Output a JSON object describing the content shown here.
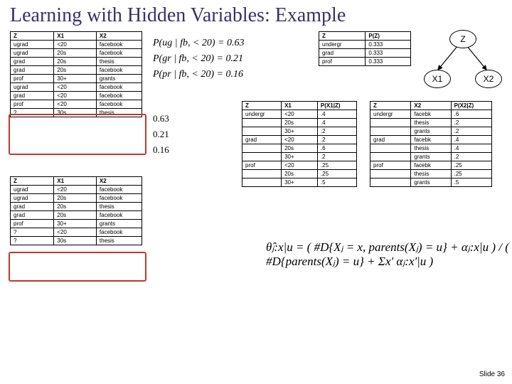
{
  "title": "Learning with Hidden Variables: Example",
  "slide_number": "Slide 36",
  "diagram": {
    "Z": "Z",
    "X1": "X1",
    "X2": "X2"
  },
  "tableA": {
    "headers": [
      "Z",
      "X1",
      "X2"
    ],
    "rows": [
      [
        "ugrad",
        "<20",
        "facebook"
      ],
      [
        "ugrad",
        "20s",
        "facebook"
      ],
      [
        "grad",
        "20s",
        "thesis"
      ],
      [
        "grad",
        "20s",
        "facebook"
      ],
      [
        "prof",
        "30+",
        "grants"
      ],
      [
        "ugrad",
        "<20",
        "facebook"
      ],
      [
        "grad",
        "<20",
        "facebook"
      ],
      [
        "prof",
        "<20",
        "facebook"
      ],
      [
        "?",
        "30s",
        "thesis"
      ]
    ]
  },
  "tableC": {
    "headers": [
      "Z",
      "X1",
      "X2"
    ],
    "rows": [
      [
        "ugrad",
        "<20",
        "facebook"
      ],
      [
        "ugrad",
        "20s",
        "facebook"
      ],
      [
        "grad",
        "20s",
        "thesis"
      ],
      [
        "grad",
        "20s",
        "facebook"
      ],
      [
        "prof",
        "30+",
        "grants"
      ],
      [
        "?",
        "<20",
        "facebook"
      ],
      [
        "?",
        "30s",
        "thesis"
      ]
    ]
  },
  "tableB": {
    "headers": [
      "Z",
      "P(Z)"
    ],
    "rows": [
      [
        "undergr",
        "0.333"
      ],
      [
        "grad",
        "0.333"
      ],
      [
        "prof",
        "0.333"
      ]
    ]
  },
  "tableD": {
    "headers": [
      "Z",
      "X1",
      "P(X1|Z)"
    ],
    "rows": [
      [
        "undergr",
        "<20",
        ".4"
      ],
      [
        "",
        "20s",
        ".4"
      ],
      [
        "",
        "30+",
        ".2"
      ],
      [
        "grad",
        "<20",
        ".2"
      ],
      [
        "",
        "20s",
        ".6"
      ],
      [
        "",
        "30+",
        ".2"
      ],
      [
        "prof",
        "<20",
        ".25"
      ],
      [
        "",
        "20s",
        ".25"
      ],
      [
        "",
        "30+",
        ".5"
      ]
    ]
  },
  "tableE": {
    "headers": [
      "Z",
      "X2",
      "P(X2|Z)"
    ],
    "rows": [
      [
        "undergr",
        "facebk",
        ".6"
      ],
      [
        "",
        "thesis",
        ".2"
      ],
      [
        "",
        "grants",
        ".2"
      ],
      [
        "grad",
        "facebk",
        ".4"
      ],
      [
        "",
        "thesis",
        ".4"
      ],
      [
        "",
        "grants",
        ".2"
      ],
      [
        "prof",
        "facebk",
        ".25"
      ],
      [
        "",
        "thesis",
        ".25"
      ],
      [
        "",
        "grants",
        ".5"
      ]
    ]
  },
  "formulas1": [
    "P(ug | fb, < 20) = 0.63",
    "P(gr | fb, < 20) = 0.21",
    "P(pr | fb, < 20) = 0.16"
  ],
  "formulas2": [
    "0.63",
    "0.21",
    "0.16"
  ],
  "formula3": "θ̂ⱼ:x|u = ( #D{Xⱼ = x, parents(Xⱼ) = u} + αⱼ:x|u ) / ( #D{parents(Xⱼ) = u} + Σx' αⱼ:x'|u )"
}
